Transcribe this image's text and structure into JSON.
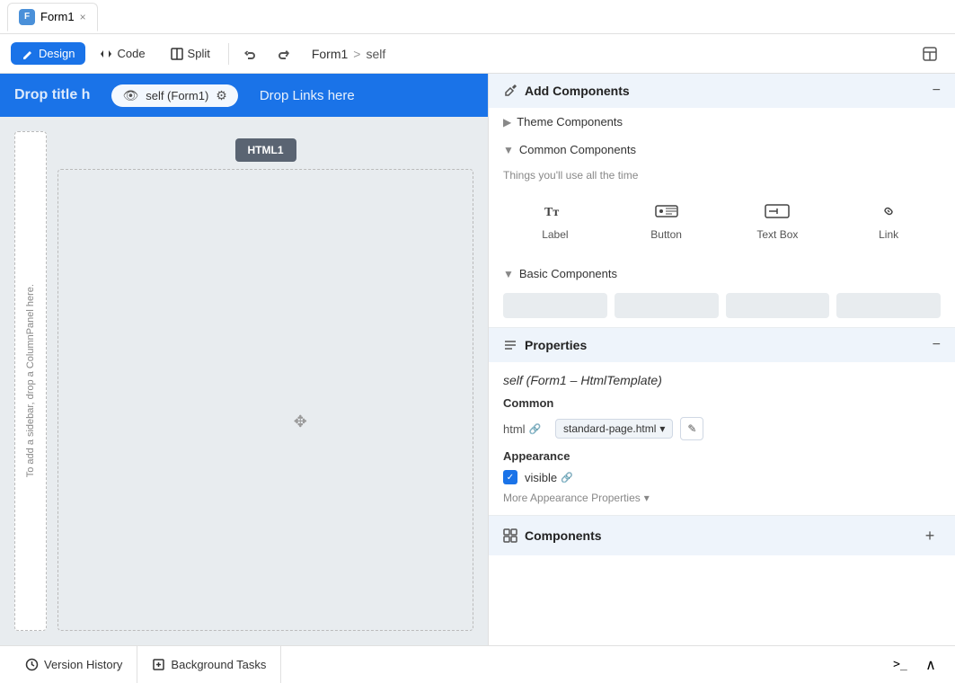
{
  "tab": {
    "icon_label": "F",
    "title": "Form1",
    "close_label": "×"
  },
  "toolbar": {
    "design_label": "Design",
    "code_label": "Code",
    "split_label": "Split",
    "undo_label": "↺",
    "redo_label": "↻",
    "breadcrumb_form": "Form1",
    "breadcrumb_sep": ">",
    "breadcrumb_page": "self"
  },
  "canvas": {
    "drop_title": "Drop title h",
    "nav_pill_label": "self (Form1)",
    "drop_links": "Drop Links here",
    "html_badge": "HTML1",
    "sidebar_panel_text": "To add a sidebar, drop a ColumnPanel here."
  },
  "add_components": {
    "section_title": "Add Components",
    "collapse_icon": "−",
    "theme_label": "Theme Components",
    "common_label": "Common Components",
    "common_hint": "Things you'll use all the time",
    "components": [
      {
        "icon_type": "label",
        "label": "Label"
      },
      {
        "icon_type": "button",
        "label": "Button"
      },
      {
        "icon_type": "textbox",
        "label": "Text Box"
      },
      {
        "icon_type": "link",
        "label": "Link"
      }
    ],
    "basic_label": "Basic Components"
  },
  "properties": {
    "section_title": "Properties",
    "collapse_icon": "−",
    "component_title": "self (Form1 – HtmlTemplate)",
    "common_label": "Common",
    "html_key": "html",
    "html_value": "standard-page.html",
    "dropdown_icon": "▾",
    "edit_icon": "✎",
    "appearance_label": "Appearance",
    "visible_label": "visible",
    "more_label": "More Appearance Properties",
    "more_chevron": "▾"
  },
  "components_section": {
    "title": "Components",
    "add_icon": "+"
  },
  "bottom_bar": {
    "version_history_label": "Version History",
    "background_tasks_label": "Background Tasks",
    "terminal_icon": ">_",
    "up_icon": "∧"
  }
}
